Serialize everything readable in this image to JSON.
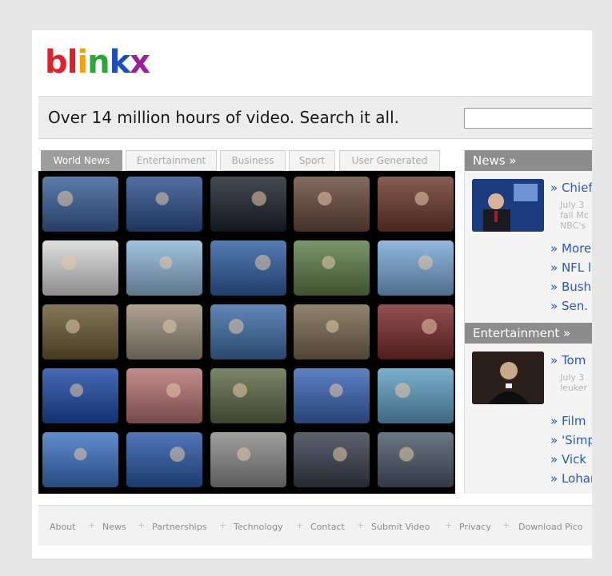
{
  "logo": {
    "letters": [
      "b",
      "l",
      "i",
      "n",
      "k",
      "x"
    ],
    "colors": [
      "#e0202a",
      "#e0202a",
      "#f1a10c",
      "#2aa63a",
      "#1f4fb5",
      "#9b1f9b"
    ]
  },
  "search": {
    "tagline": "Over 14 million hours of video. Search it all.",
    "placeholder": ""
  },
  "tabs": [
    {
      "label": "World News",
      "active": true
    },
    {
      "label": "Entertainment",
      "active": false
    },
    {
      "label": "Business",
      "active": false
    },
    {
      "label": "Sport",
      "active": false
    },
    {
      "label": "User Generated",
      "active": false
    }
  ],
  "video_grid": {
    "rows": 5,
    "cols": 5,
    "thumbnail_colors": [
      "#3a5f9a",
      "#2d4f8e",
      "#1e2330",
      "#6b4a3d",
      "#6d3a2a",
      "#d8d8d8",
      "#8fb6d6",
      "#315fa3",
      "#5f7f4a",
      "#7aa9d8",
      "#6b5a35",
      "#9c8f7c",
      "#3f6ea8",
      "#7a6a4e",
      "#7b2b2b",
      "#1f4aa8",
      "#b77373",
      "#5f6b47",
      "#3c66b6",
      "#5f9fc4",
      "#3d73c4",
      "#2c5aa8",
      "#8b8b8b",
      "#3a4050",
      "#4c5a6a"
    ]
  },
  "sidebar": {
    "news": {
      "header": "News »",
      "lead_title": "» Chief",
      "lead_desc": "July 3\nfall Mc\nNBC's",
      "links": [
        "» More",
        "» NFL l",
        "» Bush",
        "» Sen."
      ]
    },
    "entertainment": {
      "header": "Entertainment »",
      "lead_title": "» Tom",
      "lead_desc": "July 3\nleuker",
      "links": [
        "» Film",
        "» 'Simp",
        "» Vick",
        "» Lohar"
      ]
    }
  },
  "footer": {
    "links": [
      "About",
      "News",
      "Partnerships",
      "Technology",
      "Contact",
      "Submit Video",
      "Privacy",
      "Download Pico"
    ],
    "separator": "+"
  }
}
